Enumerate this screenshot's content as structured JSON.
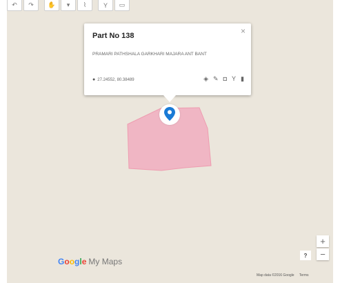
{
  "toolbar": {
    "buttons": [
      {
        "name": "undo-button",
        "icon": "undo-icon",
        "glyph": "↶"
      },
      {
        "name": "redo-button",
        "icon": "redo-icon",
        "glyph": "↷"
      },
      {
        "name": "pan-button",
        "icon": "hand-icon",
        "glyph": "✋"
      },
      {
        "name": "marker-button",
        "icon": "marker-icon",
        "glyph": "▾"
      },
      {
        "name": "line-button",
        "icon": "draw-line-icon",
        "glyph": "⌇"
      },
      {
        "name": "directions-button",
        "icon": "directions-icon",
        "glyph": "Y"
      },
      {
        "name": "measure-button",
        "icon": "ruler-icon",
        "glyph": "▭"
      }
    ]
  },
  "info_window": {
    "title": "Part No 138",
    "description": "PRAMARI PATHSHALA GARKHARI MAJARA ANT BANT",
    "coordinates": "27.24552, 80.38489",
    "close_glyph": "×",
    "actions": [
      {
        "name": "style-button",
        "icon": "paint-bucket-icon",
        "glyph": "◈"
      },
      {
        "name": "edit-button",
        "icon": "pencil-icon",
        "glyph": "✎"
      },
      {
        "name": "photo-button",
        "icon": "camera-icon",
        "glyph": "◘"
      },
      {
        "name": "directions-button",
        "icon": "directions-icon",
        "glyph": "Y"
      },
      {
        "name": "delete-button",
        "icon": "trash-icon",
        "glyph": "▮"
      }
    ]
  },
  "polygon": {
    "fill": "#f0b6c4",
    "stroke": "#ee9cb0"
  },
  "marker": {
    "color": "#1a7bd6"
  },
  "logo": {
    "google": "Google",
    "suffix": "My Maps"
  },
  "controls": {
    "zoom_in": "+",
    "zoom_out": "−",
    "help": "?"
  },
  "attribution": {
    "map_data": "Map data ©2016 Google",
    "terms": "Terms"
  }
}
